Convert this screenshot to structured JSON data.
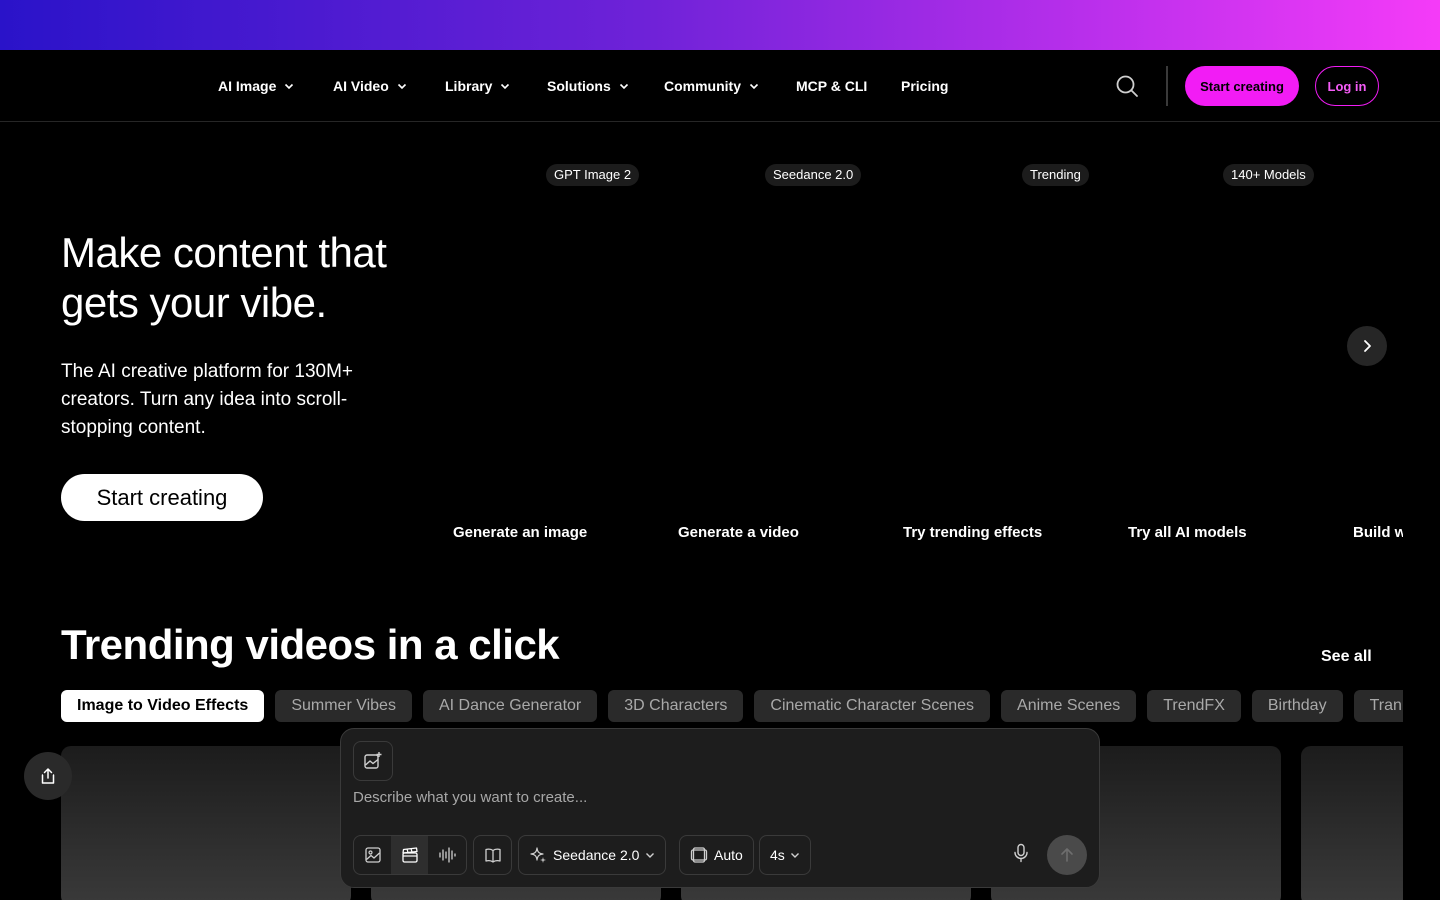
{
  "nav": {
    "items": [
      {
        "label": "AI Image",
        "has_dropdown": true
      },
      {
        "label": "AI Video",
        "has_dropdown": true
      },
      {
        "label": "Library",
        "has_dropdown": true
      },
      {
        "label": "Solutions",
        "has_dropdown": true
      },
      {
        "label": "Community",
        "has_dropdown": true
      },
      {
        "label": "MCP & CLI",
        "has_dropdown": false
      },
      {
        "label": "Pricing",
        "has_dropdown": false
      }
    ],
    "start_label": "Start creating",
    "login_label": "Log in"
  },
  "hero": {
    "title": "Make content that gets your vibe.",
    "subtitle": "The AI creative platform for 130M+ creators. Turn any idea into scroll-stopping content.",
    "cta_label": "Start creating"
  },
  "carousel": {
    "cards": [
      {
        "badge": "GPT Image 2",
        "label": "Generate an image"
      },
      {
        "badge": "Seedance 2.0",
        "label": "Generate a video"
      },
      {
        "badge": "Trending",
        "label": "Try trending effects"
      },
      {
        "badge": "140+ Models",
        "label": "Try all AI models"
      },
      {
        "badge": "",
        "label": "Build w"
      }
    ]
  },
  "trending": {
    "title": "Trending videos in a click",
    "see_all": "See all",
    "chips": [
      "Image to Video Effects",
      "Summer Vibes",
      "AI Dance Generator",
      "3D Characters",
      "Cinematic Character Scenes",
      "Anime Scenes",
      "TrendFX",
      "Birthday",
      "Tran"
    ],
    "active_chip": 0
  },
  "composer": {
    "placeholder": "Describe what you want to create...",
    "model_label": "Seedance 2.0",
    "aspect_label": "Auto",
    "duration_label": "4s"
  },
  "colors": {
    "accent": "#f21cf5",
    "banner_start": "#2a13c9",
    "banner_end": "#f53bf8"
  }
}
